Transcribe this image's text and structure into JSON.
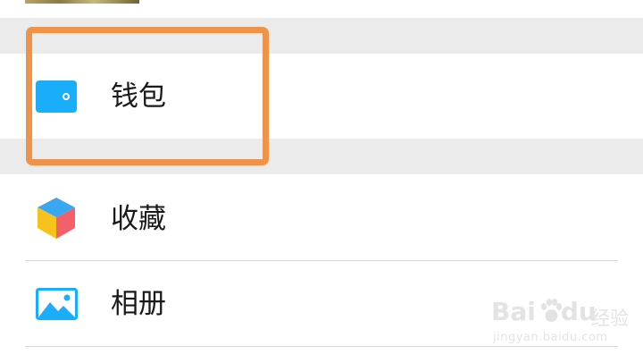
{
  "menu": {
    "items": [
      {
        "label": "钱包",
        "icon": "wallet-icon",
        "color": "#1aadf9"
      },
      {
        "label": "收藏",
        "icon": "favorites-cube-icon"
      },
      {
        "label": "相册",
        "icon": "album-icon",
        "color": "#1aadf9"
      }
    ]
  },
  "highlight": {
    "color": "#f0934a"
  },
  "watermark": {
    "brand": "Bai",
    "brand_tail": "du",
    "suffix": "经验",
    "url": "jingyan.baidu.com"
  }
}
